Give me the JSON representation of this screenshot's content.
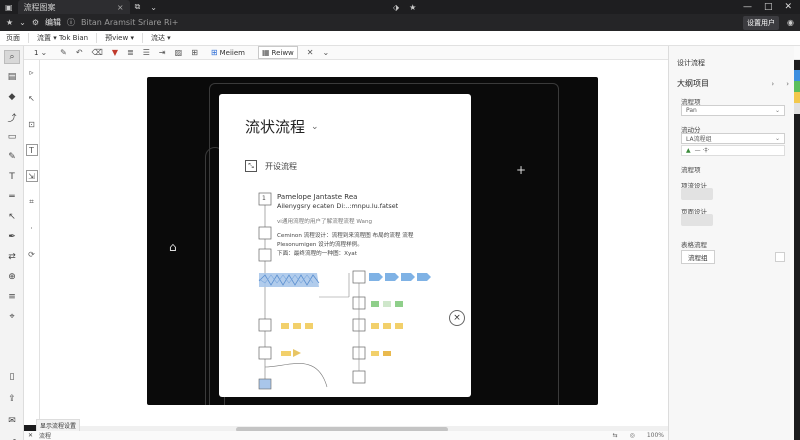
{
  "titlebar": {
    "tab_label": "流程图案",
    "tab_close": "×",
    "extra_tab_icon": "⧉",
    "controls": {
      "minimize": "—",
      "maximize": "□",
      "close": "✕"
    }
  },
  "addrbar": {
    "label": "编辑",
    "field": "Bitan Aramsit Sriare Ri+",
    "badge": "设置用户"
  },
  "toolbar1": {
    "items": [
      "页面",
      "流置 ▾ Tok Bian",
      "预view ▾",
      "流达 ▾"
    ]
  },
  "toolbar2": {
    "num": "1",
    "btn_a": "Meiiem",
    "btn_b": "Reiww",
    "close": "✕"
  },
  "card": {
    "title": "流状流程",
    "title_chevron": "⌄",
    "sub_label": "开设流程",
    "close": "×",
    "flow_heading": "Pamelope Jantaste Rea",
    "flow_sub": "Ailenygsry ecaten Di:..:mnpu.lu.fatset",
    "note1": "vi通用流程的用户了解流程流程 Wang",
    "note2a": "Ceminon 流程设计：流程到来流程图 布局的流程 流程",
    "note2b": "Plesonumigen 设计的流程样例。",
    "note2c": "下面：最终流程的一种图：Xyat",
    "node": "1"
  },
  "rpanel": {
    "header": "设计流程",
    "section": "大纲项目",
    "f1_label": "流程项",
    "f1_value": "Pan",
    "f2_label": "流动分",
    "f2_value": "LA流程组",
    "f2_extra": "— ·‡·",
    "f3_label": "流程项",
    "f4_label": "项流设计",
    "f5_label": "页面设计",
    "f6_label": "表格流程",
    "f6_value": "流程组"
  },
  "statusbar": {
    "tooltip": "显示流程设置",
    "left": "流程",
    "right": [
      "⇆",
      "◎",
      "100%"
    ]
  }
}
